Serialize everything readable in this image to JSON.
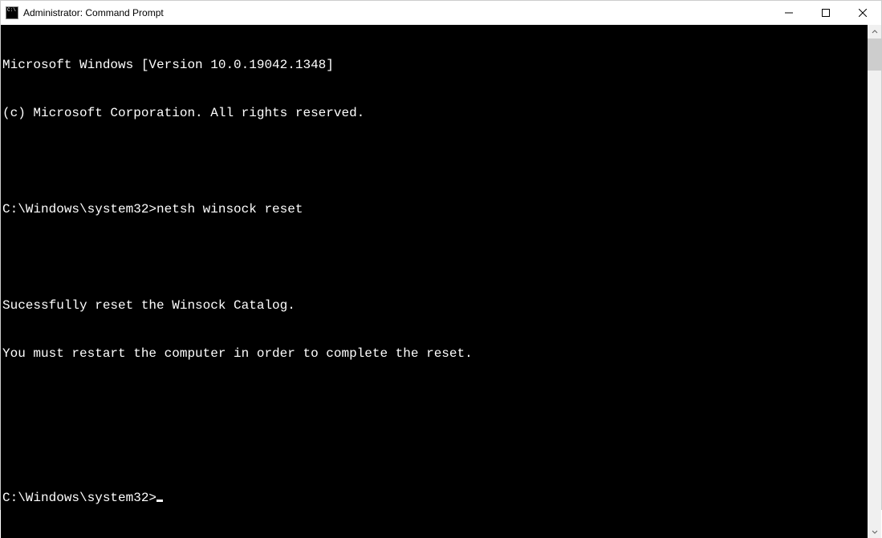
{
  "window": {
    "title": "Administrator: Command Prompt"
  },
  "terminal": {
    "banner1": "Microsoft Windows [Version 10.0.19042.1348]",
    "banner2": "(c) Microsoft Corporation. All rights reserved.",
    "prompt1": "C:\\Windows\\system32>",
    "command1": "netsh winsock reset",
    "output1": "Sucessfully reset the Winsock Catalog.",
    "output2": "You must restart the computer in order to complete the reset.",
    "prompt2": "C:\\Windows\\system32>"
  }
}
